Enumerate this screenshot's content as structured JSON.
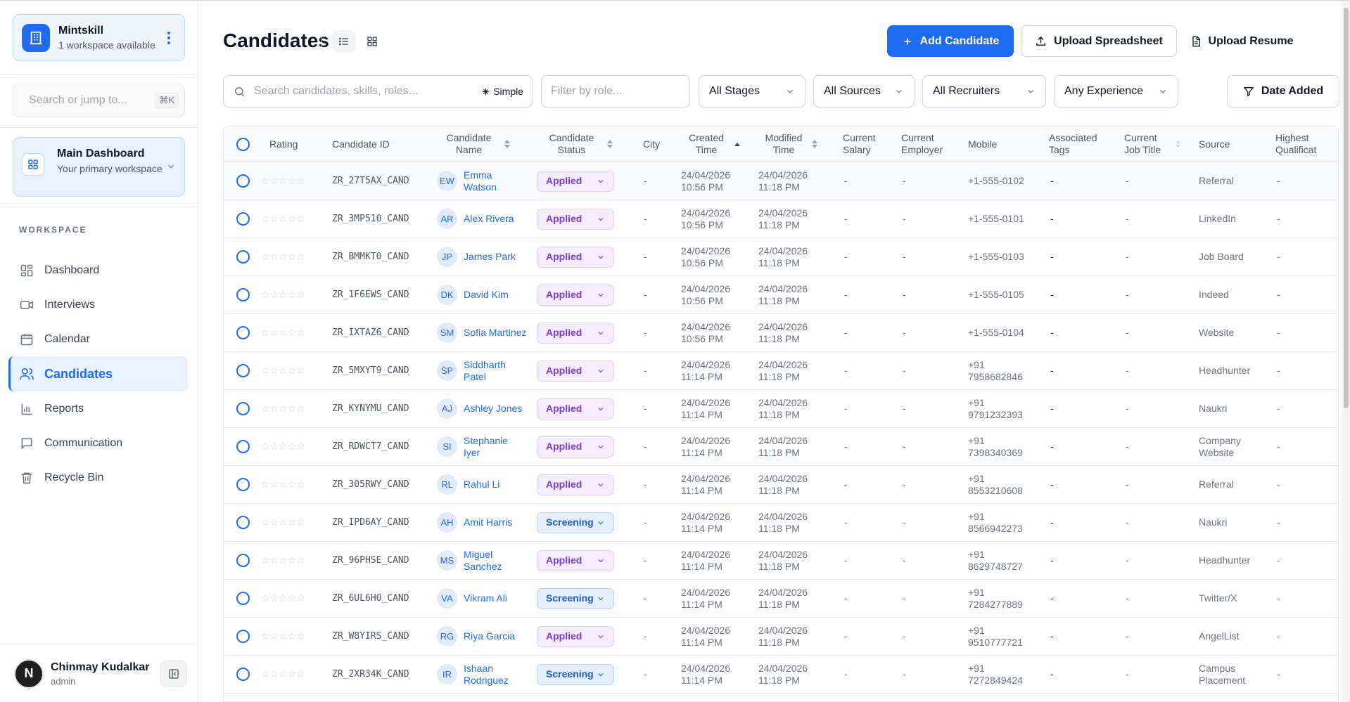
{
  "workspace": {
    "name": "Mintskill",
    "sub": "1 workspace available"
  },
  "search": {
    "placeholder": "Search or jump to...",
    "shortcut": "⌘K"
  },
  "dashboard_card": {
    "title": "Main Dashboard",
    "sub": "Your primary workspace"
  },
  "nav": {
    "section": "WORKSPACE",
    "items": [
      {
        "label": "Dashboard",
        "icon": "grid-icon"
      },
      {
        "label": "Interviews",
        "icon": "video-icon"
      },
      {
        "label": "Calendar",
        "icon": "calendar-icon"
      },
      {
        "label": "Candidates",
        "icon": "users-icon"
      },
      {
        "label": "Reports",
        "icon": "bar-chart-icon"
      },
      {
        "label": "Communication",
        "icon": "message-icon"
      },
      {
        "label": "Recycle Bin",
        "icon": "trash-icon"
      }
    ],
    "active": "Candidates"
  },
  "user": {
    "initial": "N",
    "name": "Chinmay Kudalkar",
    "role": "admin"
  },
  "page": {
    "title": "Candidates"
  },
  "toolbar": {
    "add": "Add Candidate",
    "upload_sheet": "Upload Spreadsheet",
    "upload_resume": "Upload Resume"
  },
  "filters": {
    "search_placeholder": "Search candidates, skills, roles...",
    "mode": "Simple",
    "role_placeholder": "Filter by role...",
    "stages": "All Stages",
    "sources": "All Sources",
    "recruiters": "All Recruiters",
    "experience": "Any Experience",
    "date": "Date Added"
  },
  "table": {
    "columns": {
      "rating": "Rating",
      "id": "Candidate ID",
      "name": "Candidate Name",
      "status": "Candidate Status",
      "city": "City",
      "created": "Created Time",
      "modified": "Modified Time",
      "salary": "Current Salary",
      "employer": "Current Employer",
      "mobile": "Mobile",
      "tags": "Associated Tags",
      "title": "Current Job Title",
      "source": "Source",
      "qual": "Highest Qualificat"
    },
    "rows": [
      {
        "id": "ZR_27T5AX_CAND",
        "initials": "EW",
        "name": "Emma Watson",
        "status": "Applied",
        "city": "-",
        "created": "24/04/2026 10:56 PM",
        "modified": "24/04/2026 11:18 PM",
        "salary": "-",
        "employer": "-",
        "mobile": "+1-555-0102",
        "tags": "-",
        "title": "-",
        "source": "Referral",
        "qual": "-"
      },
      {
        "id": "ZR_3MP510_CAND",
        "initials": "AR",
        "name": "Alex Rivera",
        "status": "Applied",
        "city": "-",
        "created": "24/04/2026 10:56 PM",
        "modified": "24/04/2026 11:18 PM",
        "salary": "-",
        "employer": "-",
        "mobile": "+1-555-0101",
        "tags": "-",
        "title": "-",
        "source": "LinkedIn",
        "qual": "-"
      },
      {
        "id": "ZR_BMMKT0_CAND",
        "initials": "JP",
        "name": "James Park",
        "status": "Applied",
        "city": "-",
        "created": "24/04/2026 10:56 PM",
        "modified": "24/04/2026 11:18 PM",
        "salary": "-",
        "employer": "-",
        "mobile": "+1-555-0103",
        "tags": "-",
        "title": "-",
        "source": "Job Board",
        "qual": "-"
      },
      {
        "id": "ZR_1F6EWS_CAND",
        "initials": "DK",
        "name": "David Kim",
        "status": "Applied",
        "city": "-",
        "created": "24/04/2026 10:56 PM",
        "modified": "24/04/2026 11:18 PM",
        "salary": "-",
        "employer": "-",
        "mobile": "+1-555-0105",
        "tags": "-",
        "title": "-",
        "source": "Indeed",
        "qual": "-"
      },
      {
        "id": "ZR_IXTAZ6_CAND",
        "initials": "SM",
        "name": "Sofia Martinez",
        "status": "Applied",
        "city": "-",
        "created": "24/04/2026 10:56 PM",
        "modified": "24/04/2026 11:18 PM",
        "salary": "-",
        "employer": "-",
        "mobile": "+1-555-0104",
        "tags": "-",
        "title": "-",
        "source": "Website",
        "qual": "-"
      },
      {
        "id": "ZR_5MXYT9_CAND",
        "initials": "SP",
        "name": "Siddharth Patel",
        "status": "Applied",
        "city": "-",
        "created": "24/04/2026 11:14 PM",
        "modified": "24/04/2026 11:18 PM",
        "salary": "-",
        "employer": "-",
        "mobile": "+91 7958682846",
        "tags": "-",
        "title": "-",
        "source": "Headhunter",
        "qual": "-"
      },
      {
        "id": "ZR_KYNYMU_CAND",
        "initials": "AJ",
        "name": "Ashley Jones",
        "status": "Applied",
        "city": "-",
        "created": "24/04/2026 11:14 PM",
        "modified": "24/04/2026 11:18 PM",
        "salary": "-",
        "employer": "-",
        "mobile": "+91 9791232393",
        "tags": "-",
        "title": "-",
        "source": "Naukri",
        "qual": "-"
      },
      {
        "id": "ZR_RDWCT7_CAND",
        "initials": "SI",
        "name": "Stephanie Iyer",
        "status": "Applied",
        "city": "-",
        "created": "24/04/2026 11:14 PM",
        "modified": "24/04/2026 11:18 PM",
        "salary": "-",
        "employer": "-",
        "mobile": "+91 7398340369",
        "tags": "-",
        "title": "-",
        "source": "Company Website",
        "qual": "-"
      },
      {
        "id": "ZR_305RWY_CAND",
        "initials": "RL",
        "name": "Rahul Li",
        "status": "Applied",
        "city": "-",
        "created": "24/04/2026 11:14 PM",
        "modified": "24/04/2026 11:18 PM",
        "salary": "-",
        "employer": "-",
        "mobile": "+91 8553210608",
        "tags": "-",
        "title": "-",
        "source": "Referral",
        "qual": "-"
      },
      {
        "id": "ZR_IPD6AY_CAND",
        "initials": "AH",
        "name": "Amit Harris",
        "status": "Screening",
        "city": "-",
        "created": "24/04/2026 11:14 PM",
        "modified": "24/04/2026 11:18 PM",
        "salary": "-",
        "employer": "-",
        "mobile": "+91 8566942273",
        "tags": "-",
        "title": "-",
        "source": "Naukri",
        "qual": "-"
      },
      {
        "id": "ZR_96PHSE_CAND",
        "initials": "MS",
        "name": "Miguel Sanchez",
        "status": "Applied",
        "city": "-",
        "created": "24/04/2026 11:14 PM",
        "modified": "24/04/2026 11:18 PM",
        "salary": "-",
        "employer": "-",
        "mobile": "+91 8629748727",
        "tags": "-",
        "title": "-",
        "source": "Headhunter",
        "qual": "-"
      },
      {
        "id": "ZR_6UL6H0_CAND",
        "initials": "VA",
        "name": "Vikram Ali",
        "status": "Screening",
        "city": "-",
        "created": "24/04/2026 11:14 PM",
        "modified": "24/04/2026 11:18 PM",
        "salary": "-",
        "employer": "-",
        "mobile": "+91 7284277889",
        "tags": "-",
        "title": "-",
        "source": "Twitter/X",
        "qual": "-"
      },
      {
        "id": "ZR_W8YIRS_CAND",
        "initials": "RG",
        "name": "Riya Garcia",
        "status": "Applied",
        "city": "-",
        "created": "24/04/2026 11:14 PM",
        "modified": "24/04/2026 11:18 PM",
        "salary": "-",
        "employer": "-",
        "mobile": "+91 9510777721",
        "tags": "-",
        "title": "-",
        "source": "AngelList",
        "qual": "-"
      },
      {
        "id": "ZR_2XR34K_CAND",
        "initials": "IR",
        "name": "Ishaan Rodriguez",
        "status": "Screening",
        "city": "-",
        "created": "24/04/2026 11:14 PM",
        "modified": "24/04/2026 11:18 PM",
        "salary": "-",
        "employer": "-",
        "mobile": "+91 7272849424",
        "tags": "-",
        "title": "-",
        "source": "Campus Placement",
        "qual": "-"
      }
    ]
  },
  "colors": {
    "accent": "#1d6cf0",
    "applied": "#7e3bd1",
    "screening": "#1d5cc9"
  }
}
